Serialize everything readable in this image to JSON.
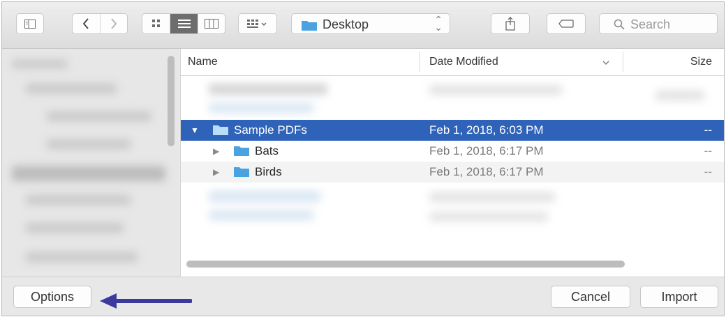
{
  "toolbar": {
    "location": "Desktop",
    "search_placeholder": "Search",
    "icons": [
      "sidebar-toggle-icon",
      "back-chevron-icon",
      "forward-chevron-icon",
      "icon-view-icon",
      "list-view-icon",
      "column-view-icon",
      "group-by-icon",
      "folder-icon",
      "stepper-icon",
      "share-icon",
      "tag-icon",
      "search-icon"
    ]
  },
  "columns": {
    "name": "Name",
    "date": "Date Modified",
    "size": "Size"
  },
  "rows": [
    {
      "name": "Sample PDFs",
      "date": "Feb 1, 2018, 6:03 PM",
      "size": "--",
      "selected": true,
      "expanded": true
    },
    {
      "name": "Bats",
      "date": "Feb 1, 2018, 6:17 PM",
      "size": "--"
    },
    {
      "name": "Birds",
      "date": "Feb 1, 2018, 6:17 PM",
      "size": "--"
    }
  ],
  "buttons": {
    "options": "Options",
    "cancel": "Cancel",
    "import": "Import"
  },
  "colors": {
    "selection": "#2e63b9",
    "folder": "#4aa3e0",
    "arrow": "#3d3a9e"
  }
}
